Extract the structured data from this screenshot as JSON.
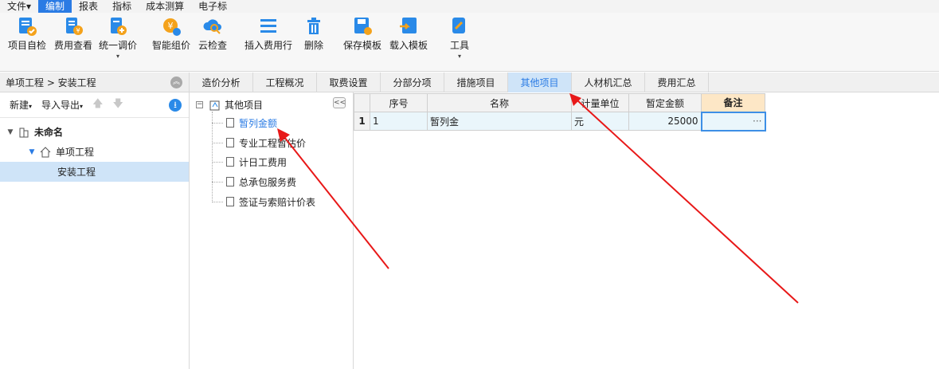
{
  "menu": {
    "items": [
      {
        "label": "文件▾",
        "active": false
      },
      {
        "label": "编制",
        "active": true
      },
      {
        "label": "报表",
        "active": false
      },
      {
        "label": "指标",
        "active": false
      },
      {
        "label": "成本测算",
        "active": false
      },
      {
        "label": "电子标",
        "active": false
      }
    ]
  },
  "ribbon": {
    "project_check": "项目自检",
    "fee_view": "费用查看",
    "unified_adjust": "统一调价",
    "smart_pricing": "智能组价",
    "cloud_check": "云检查",
    "insert_fee_row": "插入费用行",
    "delete": "删除",
    "save_template": "保存模板",
    "load_template": "载入模板",
    "tools": "工具",
    "caret": "▾"
  },
  "left": {
    "breadcrumb": "单项工程 > 安装工程",
    "collapse_icon": "︽",
    "new_label": "新建",
    "io_label": "导入导出",
    "caret": "▾",
    "up_arrow": "🡅",
    "down_arrow": "🡇",
    "download_icon": "⭳",
    "tree": [
      {
        "label": "未命名"
      },
      {
        "label": "单项工程"
      },
      {
        "label": "安装工程"
      }
    ]
  },
  "tabs": [
    {
      "label": "造价分析",
      "active": false
    },
    {
      "label": "工程概况",
      "active": false
    },
    {
      "label": "取费设置",
      "active": false
    },
    {
      "label": "分部分项",
      "active": false
    },
    {
      "label": "措施项目",
      "active": false
    },
    {
      "label": "其他项目",
      "active": true
    },
    {
      "label": "人材机汇总",
      "active": false
    },
    {
      "label": "费用汇总",
      "active": false
    }
  ],
  "midtree": {
    "root": "其他项目",
    "expand": "⊟",
    "collapse": "<<",
    "items": [
      {
        "label": "暂列金额",
        "active": true
      },
      {
        "label": "专业工程暂估价",
        "active": false
      },
      {
        "label": "计日工费用",
        "active": false
      },
      {
        "label": "总承包服务费",
        "active": false
      },
      {
        "label": "签证与索赔计价表",
        "active": false
      }
    ]
  },
  "grid": {
    "headers": [
      "序号",
      "名称",
      "计量单位",
      "暂定金额",
      "备注"
    ],
    "rows": [
      {
        "rowno": "1",
        "seq": "1",
        "name": "暂列金",
        "unit": "元",
        "amount": "25000",
        "note": "···"
      }
    ]
  },
  "colors": {
    "accent": "#2a7be4",
    "selection": "#cfe4f8",
    "annotation": "#e81818",
    "header_highlight": "#fde7c6"
  }
}
